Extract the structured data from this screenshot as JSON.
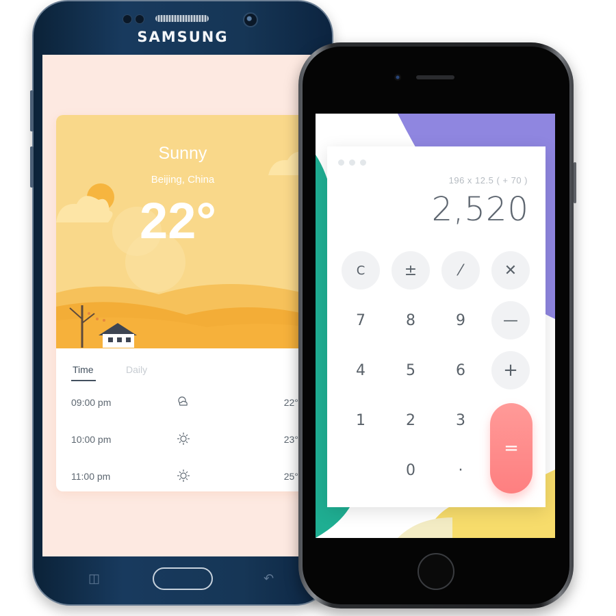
{
  "samsung": {
    "brand": "SAMSUNG",
    "weather": {
      "condition": "Sunny",
      "location": "Beijing, China",
      "temperature": "22°",
      "tabs": [
        {
          "label": "Time",
          "active": true
        },
        {
          "label": "Daily",
          "active": false
        }
      ],
      "hourly": [
        {
          "time": "09:00 pm",
          "icon": "cloud-icon",
          "temp": "22°C"
        },
        {
          "time": "10:00 pm",
          "icon": "sun-icon",
          "temp": "23°C"
        },
        {
          "time": "11:00 pm",
          "icon": "sun-icon",
          "temp": "25°C"
        }
      ]
    }
  },
  "calculator": {
    "expression": "196 x 12.5 ( + 70 )",
    "result": "2,520",
    "keys": {
      "clear": "C",
      "plus_minus": "±",
      "divide": "⁄",
      "multiply": "✕",
      "seven": "7",
      "eight": "8",
      "nine": "9",
      "minus": "—",
      "four": "4",
      "five": "5",
      "six": "6",
      "plus": "+",
      "one": "1",
      "two": "2",
      "three": "3",
      "zero": "0",
      "dot": "·",
      "equals": "="
    }
  },
  "colors": {
    "weather_sky": "#f9d88a",
    "weather_bg": "#fde9e1",
    "equals_key": "#fe8b8b",
    "calc_bg_purple": "#8f86e0",
    "calc_bg_teal": "#1fae92",
    "calc_bg_yellow": "#f7dc6b"
  }
}
